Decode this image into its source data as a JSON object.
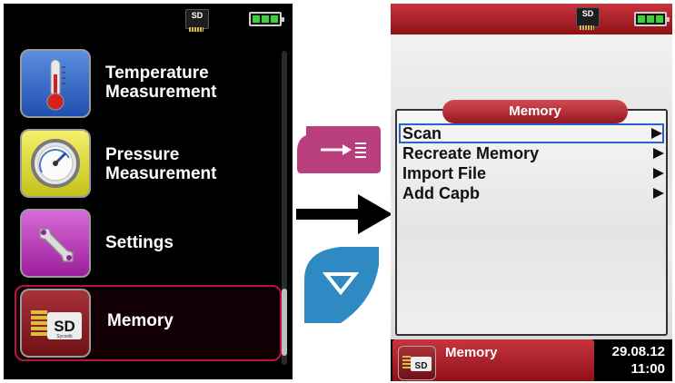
{
  "left_screen": {
    "status_bar": {
      "sd_label": "SD",
      "battery_cells": 3
    },
    "menu": [
      {
        "id": "temperature",
        "label_line1": "Temperature",
        "label_line2": "Measurement",
        "icon": "thermometer-icon"
      },
      {
        "id": "pressure",
        "label_line1": "Pressure",
        "label_line2": "Measurement",
        "icon": "pressure-gauge-icon"
      },
      {
        "id": "settings",
        "label_line1": "Settings",
        "icon": "wrench-icon"
      },
      {
        "id": "memory",
        "label_line1": "Memory",
        "icon": "sd-card-icon",
        "icon_text": "SD",
        "icon_subtext": "Syconik",
        "selected": true
      }
    ]
  },
  "controls": {
    "enter_key": {
      "icon": "enter-list-icon",
      "color": "#b83f7c"
    },
    "down_key": {
      "icon": "down-triangle-icon",
      "color": "#2f8ac4"
    },
    "flow_arrow": {
      "icon": "right-arrow-icon"
    }
  },
  "right_screen": {
    "status_bar": {
      "sd_label": "SD",
      "battery_cells": 3
    },
    "dialog": {
      "title": "Memory",
      "items": [
        {
          "label": "Scan",
          "selected": true
        },
        {
          "label": "Recreate Memory"
        },
        {
          "label": "Import File"
        },
        {
          "label": "Add Capb"
        }
      ]
    },
    "bottom_bar": {
      "title": "Memory",
      "icon_text": "SD",
      "date": "29.08.12",
      "time": "11:00"
    }
  },
  "colors": {
    "accent_red": "#b0183c",
    "selection_blue": "#2a5fd6",
    "battery_green": "#3bd23b"
  }
}
